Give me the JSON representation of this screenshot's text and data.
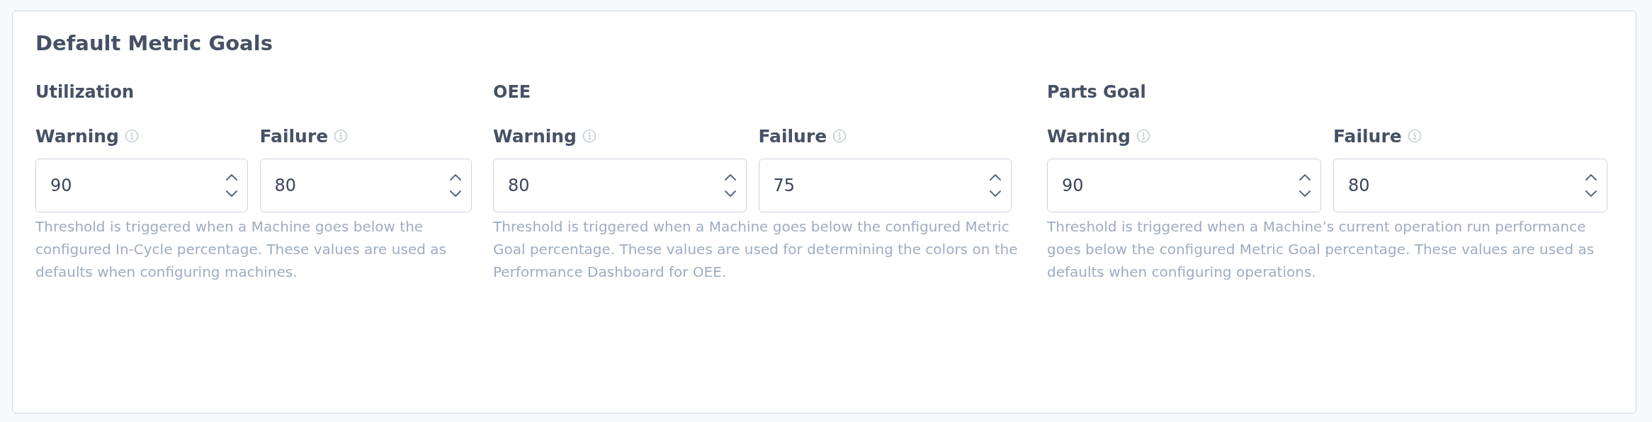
{
  "card": {
    "title": "Default Metric Goals",
    "sections": [
      {
        "title": "Utilization",
        "fields": [
          {
            "label": "Warning",
            "value": "90"
          },
          {
            "label": "Failure",
            "value": "80"
          }
        ],
        "hint": "Threshold is triggered when a Machine goes below the configured In-Cycle percentage. These values are used as defaults when configuring machines."
      },
      {
        "title": "OEE",
        "fields": [
          {
            "label": "Warning",
            "value": "80"
          },
          {
            "label": "Failure",
            "value": "75"
          }
        ],
        "hint": "Threshold is triggered when a Machine goes below the configured Metric Goal percentage. These values are used for determining the colors on the Performance Dashboard for OEE."
      },
      {
        "title": "Parts Goal",
        "fields": [
          {
            "label": "Warning",
            "value": "90"
          },
          {
            "label": "Failure",
            "value": "80"
          }
        ],
        "hint": "Threshold is triggered when a Machine’s current operation run performance goes below the configured Metric Goal percentage. These values are used as defaults when configuring operations."
      }
    ]
  }
}
